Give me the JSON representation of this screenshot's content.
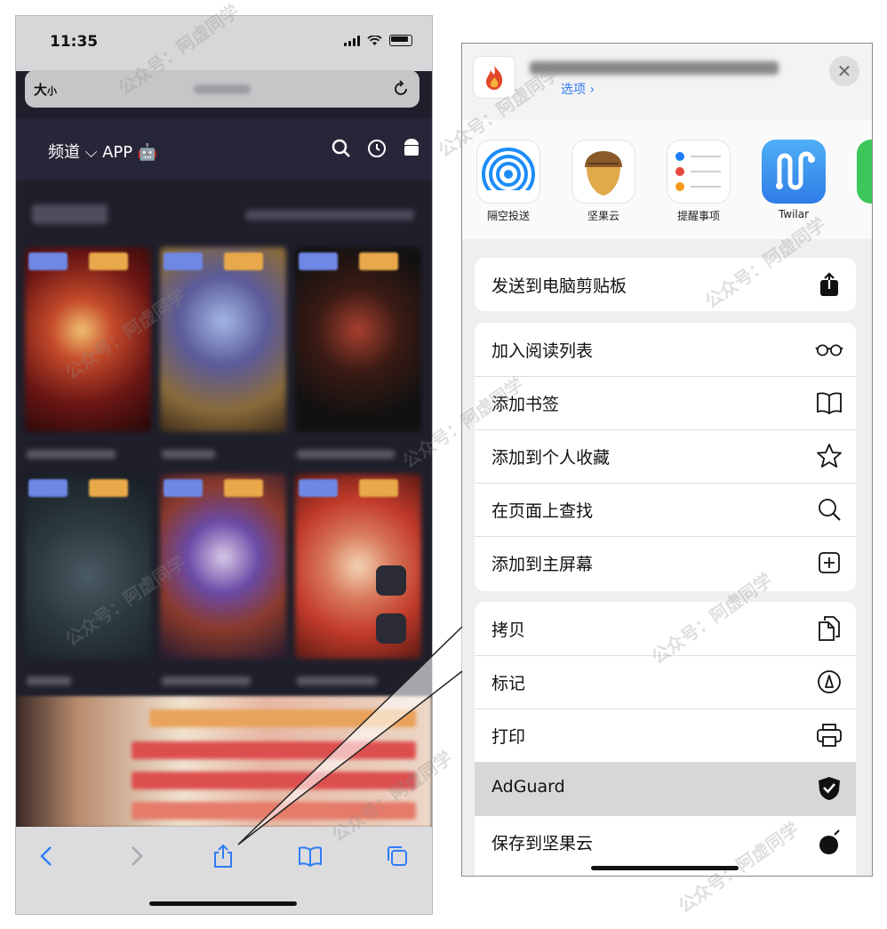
{
  "status_bar": {
    "time": "11:35"
  },
  "browser": {
    "text_size_label": "大",
    "text_size_small": "小"
  },
  "site_header": {
    "channel_label": "频道 ⌵ APP"
  },
  "share_sheet": {
    "options_label": "选项 ›",
    "close_glyph": "✕",
    "apps": [
      {
        "label": "隔空投送",
        "icon": "airdrop-icon"
      },
      {
        "label": "坚果云",
        "icon": "jianguoyun-icon"
      },
      {
        "label": "提醒事项",
        "icon": "reminders-icon"
      },
      {
        "label": "Twilar",
        "icon": "twilar-icon"
      }
    ],
    "group1": [
      {
        "label": "发送到电脑剪贴板",
        "icon": "share-box-icon"
      }
    ],
    "group2": [
      {
        "label": "加入阅读列表",
        "icon": "glasses-icon"
      },
      {
        "label": "添加书签",
        "icon": "book-icon"
      },
      {
        "label": "添加到个人收藏",
        "icon": "star-icon"
      },
      {
        "label": "在页面上查找",
        "icon": "search-icon"
      },
      {
        "label": "添加到主屏幕",
        "icon": "add-square-icon"
      }
    ],
    "group3": [
      {
        "label": "拷贝",
        "icon": "copy-icon"
      },
      {
        "label": "标记",
        "icon": "markup-icon"
      },
      {
        "label": "打印",
        "icon": "printer-icon"
      },
      {
        "label": "AdGuard",
        "icon": "adguard-shield-icon",
        "highlighted": true
      },
      {
        "label": "保存到坚果云",
        "icon": "nut-icon"
      }
    ]
  },
  "watermark": "公众号：阿虚同学",
  "colors": {
    "ios_blue": "#2f7cf6",
    "highlight_row": "#d7d7d7"
  }
}
